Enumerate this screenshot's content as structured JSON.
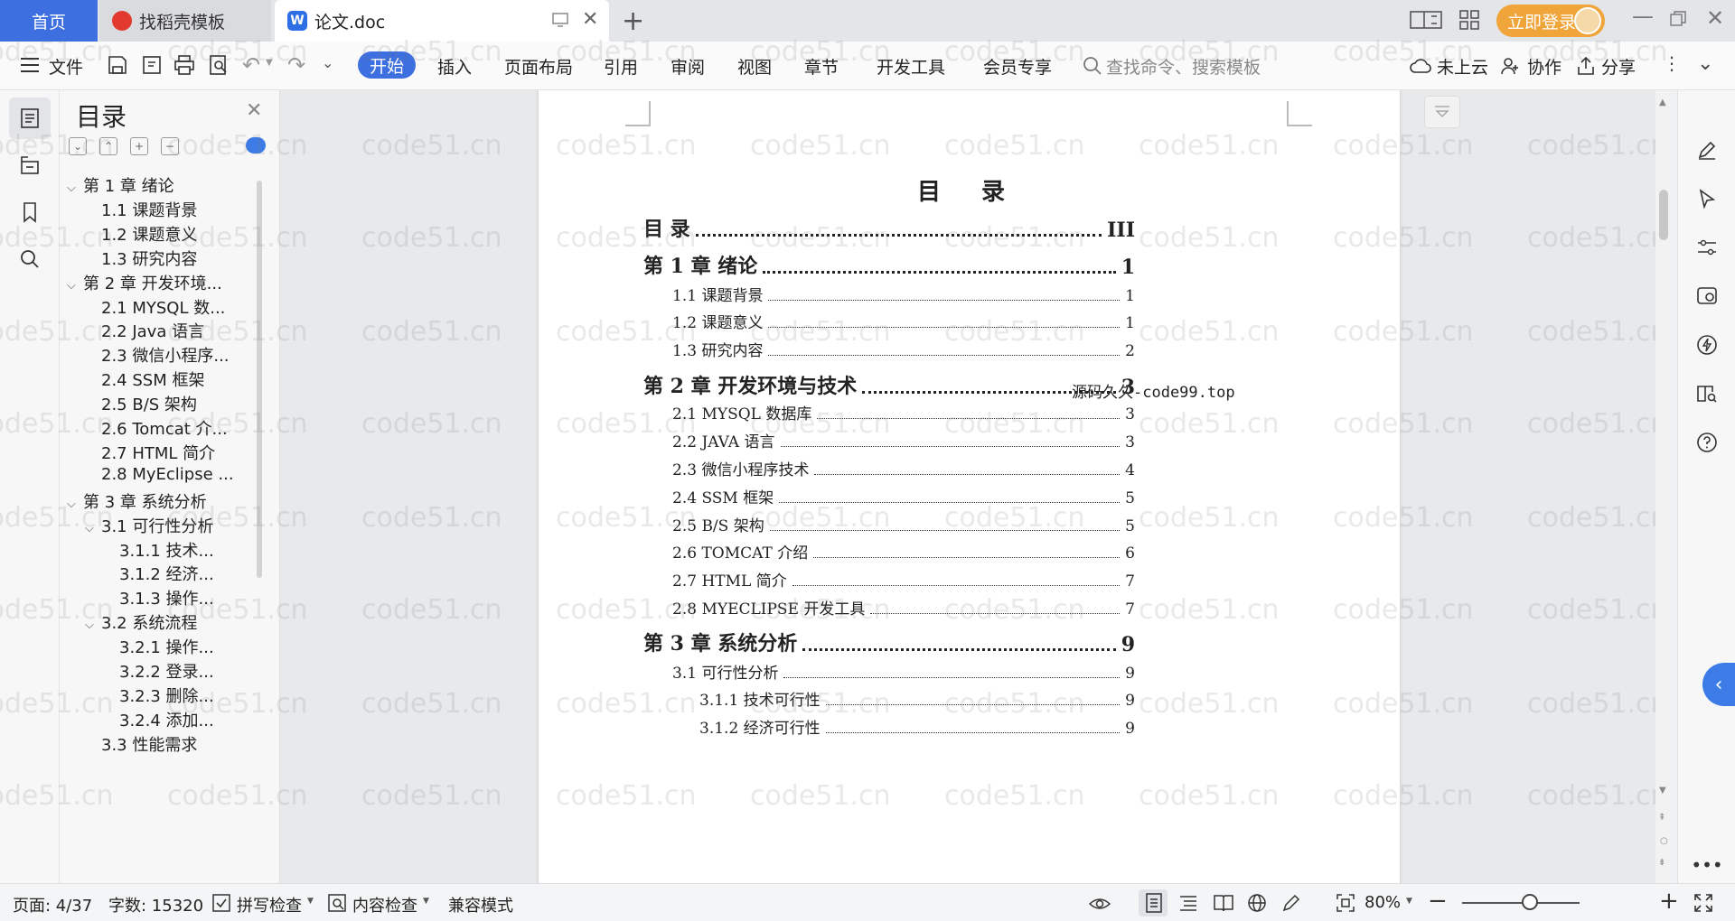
{
  "tabs": {
    "home": "首页",
    "daoke": "找稻壳模板",
    "doc": "论文.doc"
  },
  "header": {
    "login": "立即登录"
  },
  "ribbon": {
    "file": "文件",
    "items": [
      "开始",
      "插入",
      "页面布局",
      "引用",
      "审阅",
      "视图",
      "章节",
      "开发工具",
      "会员专享"
    ],
    "search_placeholder": "查找命令、搜索模板",
    "cloud": "未上云",
    "collab": "协作",
    "share": "分享"
  },
  "toc_panel": {
    "title": "目录",
    "items": [
      {
        "label": "第 1 章  绪论",
        "level": 1,
        "expanded": true
      },
      {
        "label": "1.1  课题背景",
        "level": 2
      },
      {
        "label": "1.2  课题意义",
        "level": 2
      },
      {
        "label": "1.3  研究内容",
        "level": 2
      },
      {
        "label": "第 2 章  开发环境...",
        "level": 1,
        "expanded": true
      },
      {
        "label": "2.1 MYSQL 数...",
        "level": 2
      },
      {
        "label": "2.2 Java 语言",
        "level": 2
      },
      {
        "label": "2.3  微信小程序...",
        "level": 2
      },
      {
        "label": "2.4 SSM 框架",
        "level": 2
      },
      {
        "label": "2.5 B/S 架构",
        "level": 2
      },
      {
        "label": "2.6 Tomcat 介...",
        "level": 2
      },
      {
        "label": "2.7 HTML 简介",
        "level": 2
      },
      {
        "label": "2.8 MyEclipse ...",
        "level": 2
      },
      {
        "label": "第 3 章  系统分析",
        "level": 1,
        "expanded": true
      },
      {
        "label": "3.1  可行性分析",
        "level": 2,
        "expanded": true
      },
      {
        "label": "3.1.1  技术...",
        "level": 3
      },
      {
        "label": "3.1.2  经济...",
        "level": 3
      },
      {
        "label": "3.1.3  操作...",
        "level": 3
      },
      {
        "label": "3.2  系统流程",
        "level": 2,
        "expanded": true
      },
      {
        "label": "3.2.1  操作...",
        "level": 3
      },
      {
        "label": "3.2.2  登录...",
        "level": 3
      },
      {
        "label": "3.2.3  删除...",
        "level": 3
      },
      {
        "label": "3.2.4  添加...",
        "level": 3
      },
      {
        "label": "3.3  性能需求",
        "level": 2
      }
    ]
  },
  "document": {
    "heading": "目  录",
    "stamp": "源码久久-code99.top",
    "entries": [
      {
        "text": "目    录",
        "page": "III",
        "level": 1
      },
      {
        "text": "第 1 章  绪论",
        "page": "1",
        "level": 1
      },
      {
        "text": "1.1  课题背景",
        "page": "1",
        "level": 2
      },
      {
        "text": "1.2  课题意义",
        "page": "1",
        "level": 2
      },
      {
        "text": "1.3  研究内容",
        "page": "2",
        "level": 2
      },
      {
        "text": "第 2 章  开发环境与技术",
        "page": "3",
        "level": 1
      },
      {
        "text": "2.1 MYSQL 数据库",
        "page": "3",
        "level": 2
      },
      {
        "text": "2.2 JAVA 语言",
        "page": "3",
        "level": 2
      },
      {
        "text": "2.3  微信小程序技术",
        "page": "4",
        "level": 2
      },
      {
        "text": "2.4 SSM 框架",
        "page": "5",
        "level": 2
      },
      {
        "text": "2.5 B/S 架构",
        "page": "5",
        "level": 2
      },
      {
        "text": "2.6 TOMCAT 介绍",
        "page": "6",
        "level": 2
      },
      {
        "text": "2.7 HTML 简介",
        "page": "7",
        "level": 2
      },
      {
        "text": "2.8 MYECLIPSE 开发工具",
        "page": "7",
        "level": 2
      },
      {
        "text": "第 3 章  系统分析",
        "page": "9",
        "level": 1
      },
      {
        "text": "3.1  可行性分析",
        "page": "9",
        "level": 2
      },
      {
        "text": "3.1.1  技术可行性",
        "page": "9",
        "level": 3
      },
      {
        "text": "3.1.2  经济可行性",
        "page": "9",
        "level": 3
      }
    ]
  },
  "watermark": "code51.cn",
  "status": {
    "page": "页面: 4/37",
    "words": "字数: 15320",
    "spell": "拼写检查",
    "content": "内容检查",
    "compat": "兼容模式",
    "zoom": "80%"
  },
  "colors": {
    "accent": "#3d6fe0",
    "login": "#f0a53a"
  }
}
